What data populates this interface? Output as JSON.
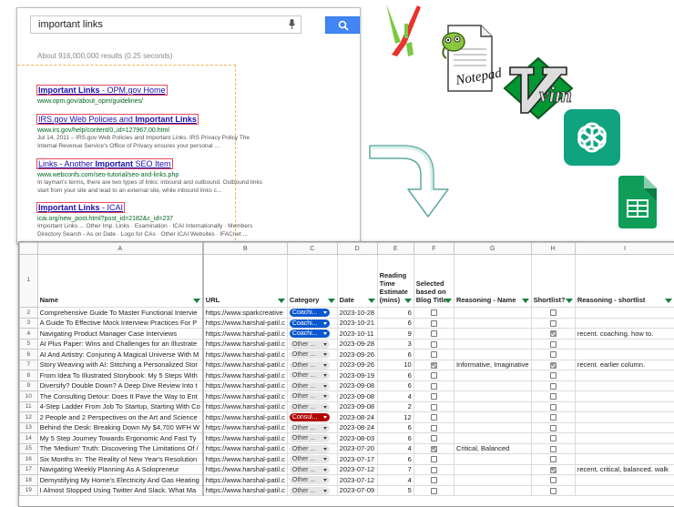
{
  "search": {
    "query": "important links",
    "stats": "About 916,000,000 results (0.25 seconds)",
    "results": [
      {
        "title_pre": "",
        "title_bold": "Important Links",
        "title_post": " - OPM.gov Home",
        "url": "www.opm.gov/about_opm/guidelines/",
        "snippet": []
      },
      {
        "title_pre": "IRS.gov Web Policies and ",
        "title_bold": "Important Links",
        "title_post": "",
        "url": "www.irs.gov/help/content/0,,id=127967,00.html",
        "snippet": [
          "Jul 14, 2011 – IRS.gov Web Policies and Important Links. IRS Privacy Policy The",
          "Internal Revenue Service's Office of Privacy ensures your personal ..."
        ]
      },
      {
        "title_pre": "Links - Another ",
        "title_bold": "Important",
        "title_post": " SEO Item",
        "url": "www.webconfs.com/seo-tutorial/seo-and-links.php",
        "snippet": [
          "In layman's terms, there are two types of links: inbound and outbound. Outbound links",
          "start from your site and lead to an external site, while inbound links c..."
        ]
      },
      {
        "title_pre": "",
        "title_bold": "Important Links",
        "title_post": " - ICAI",
        "url": "icai.org/new_post.html?post_id=2182&c_id=237",
        "snippet": [
          "Important Links ... Other Imp. Links · Examination · ICAI Internationally · Members",
          "Directory Search - As on Date · Logo for CAs · Other ICAI Websites · IFACnet ..."
        ]
      }
    ]
  },
  "logos": {
    "notepad_text": "Notepad++",
    "vim_text": "vim"
  },
  "sheet": {
    "col_letters": [
      "A",
      "B",
      "C",
      "D",
      "E",
      "F",
      "G",
      "H",
      "I"
    ],
    "headers": [
      "Name",
      "URL",
      "Category",
      "Date",
      "Reading Time Estimate (mins)",
      "Selected based on Blog Title",
      "Reasoning - Name",
      "Shortlist?",
      "Reasoning - shortlist"
    ],
    "rows": [
      {
        "n": "2",
        "name": "Comprehensive Guide To Master Functional Intervie",
        "url": "https://www.sparkcreative",
        "cat": "Coachi...",
        "ck": "coaching",
        "date": "2023-10-28",
        "time": "6",
        "sel": false,
        "rn": "",
        "sl": false,
        "rs": ""
      },
      {
        "n": "3",
        "name": "A Guide To Effective Mock Interview Practices For P",
        "url": "https://www.harshal-patil.c",
        "cat": "Coachi...",
        "ck": "coaching",
        "date": "2023-10-21",
        "time": "6",
        "sel": false,
        "rn": "",
        "sl": false,
        "rs": ""
      },
      {
        "n": "4",
        "name": "Navigating Product Manager Case Interviews",
        "url": "https://www.harshal-patil.c",
        "cat": "Coachi...",
        "ck": "coaching",
        "date": "2023-10-11",
        "time": "9",
        "sel": false,
        "rn": "",
        "sl": true,
        "rs": "recent. coaching. how to."
      },
      {
        "n": "5",
        "name": "AI Plus Paper: Wins and Challenges for an Illustrate",
        "url": "https://www.harshal-patil.c",
        "cat": "Other ...",
        "ck": "other",
        "date": "2023-09-28",
        "time": "3",
        "sel": false,
        "rn": "",
        "sl": false,
        "rs": ""
      },
      {
        "n": "6",
        "name": "AI And Artistry: Conjuring A Magical Universe With M",
        "url": "https://www.harshal-patil.c",
        "cat": "Other ...",
        "ck": "other",
        "date": "2023-09-26",
        "time": "6",
        "sel": false,
        "rn": "",
        "sl": false,
        "rs": ""
      },
      {
        "n": "7",
        "name": "Story Weaving with AI: Stitching a Personalized Stor",
        "url": "https://www.harshal-patil.c",
        "cat": "Other ...",
        "ck": "other",
        "date": "2023-09-26",
        "time": "10",
        "sel": true,
        "rn": "Informative, Imaginative",
        "sl": true,
        "rs": "recent. earlier column."
      },
      {
        "n": "8",
        "name": "From Idea To Illustrated Storybook: My 5 Steps With",
        "url": "https://www.harshal-patil.c",
        "cat": "Other ...",
        "ck": "other",
        "date": "2023-09-19",
        "time": "6",
        "sel": false,
        "rn": "",
        "sl": false,
        "rs": ""
      },
      {
        "n": "9",
        "name": "Diversify? Double Down? A Deep Dive Review Into t",
        "url": "https://www.harshal-patil.c",
        "cat": "Other ...",
        "ck": "other",
        "date": "2023-09-08",
        "time": "6",
        "sel": false,
        "rn": "",
        "sl": false,
        "rs": ""
      },
      {
        "n": "10",
        "name": "The Consulting Detour: Does It Pave the Way to Ent",
        "url": "https://www.harshal-patil.c",
        "cat": "Other ...",
        "ck": "other",
        "date": "2023-09-08",
        "time": "4",
        "sel": false,
        "rn": "",
        "sl": false,
        "rs": ""
      },
      {
        "n": "11",
        "name": "4-Step Ladder From Job To Startup, Starting With Co",
        "url": "https://www.harshal-patil.c",
        "cat": "Other ...",
        "ck": "other",
        "date": "2023-09-08",
        "time": "2",
        "sel": false,
        "rn": "",
        "sl": false,
        "rs": ""
      },
      {
        "n": "12",
        "name": "2 People and 2 Perspectives on the Art and Science",
        "url": "https://www.harshal-patil.c",
        "cat": "Consul...",
        "ck": "consulting",
        "date": "2023-08-24",
        "time": "12",
        "sel": false,
        "rn": "",
        "sl": false,
        "rs": ""
      },
      {
        "n": "13",
        "name": "Behind the Desk: Breaking Down My $4,700 WFH W",
        "url": "https://www.harshal-patil.c",
        "cat": "Other ...",
        "ck": "other",
        "date": "2023-08-24",
        "time": "6",
        "sel": false,
        "rn": "",
        "sl": false,
        "rs": ""
      },
      {
        "n": "14",
        "name": "My 5 Step Journey Towards Ergonomic And Fast Ty",
        "url": "https://www.harshal-patil.c",
        "cat": "Other ...",
        "ck": "other",
        "date": "2023-08-03",
        "time": "6",
        "sel": false,
        "rn": "",
        "sl": false,
        "rs": ""
      },
      {
        "n": "15",
        "name": "The 'Medium' Truth: Discovering The Limitations Of /",
        "url": "https://www.harshal-patil.c",
        "cat": "Other ...",
        "ck": "other",
        "date": "2023-07-20",
        "time": "4",
        "sel": true,
        "rn": "Critical, Balanced",
        "sl": false,
        "rs": ""
      },
      {
        "n": "16",
        "name": "Six Months In: The Reality of New Year's Resolution",
        "url": "https://www.harshal-patil.c",
        "cat": "Other ...",
        "ck": "other",
        "date": "2023-07-17",
        "time": "6",
        "sel": false,
        "rn": "",
        "sl": false,
        "rs": ""
      },
      {
        "n": "17",
        "name": "Navigating Weekly Planning As A Solopreneur",
        "url": "https://www.harshal-patil.c",
        "cat": "Other ...",
        "ck": "other",
        "date": "2023-07-12",
        "time": "7",
        "sel": false,
        "rn": "",
        "sl": true,
        "rs": "recent, critical, balanced. walk"
      },
      {
        "n": "18",
        "name": "Demystifying My Home's Electricity And Gas Heating",
        "url": "https://www.harshal-patil.c",
        "cat": "Other ...",
        "ck": "other",
        "date": "2023-07-12",
        "time": "4",
        "sel": false,
        "rn": "",
        "sl": false,
        "rs": ""
      },
      {
        "n": "19",
        "name": "I Almost Stopped Using Twitter And Slack. What Ma",
        "url": "https://www.harshal-patil.c",
        "cat": "Other ...",
        "ck": "other",
        "date": "2023-07-09",
        "time": "5",
        "sel": false,
        "rn": "",
        "sl": false,
        "rs": ""
      }
    ]
  },
  "colors": {
    "google_blue": "#4285f4",
    "link": "#1a0dab",
    "url_green": "#006621",
    "chatgpt": "#10a37f",
    "sheets_green": "#0f9d58",
    "vim_green": "#019833",
    "chip_coaching": "#0b57d0",
    "chip_consulting": "#b10202"
  }
}
